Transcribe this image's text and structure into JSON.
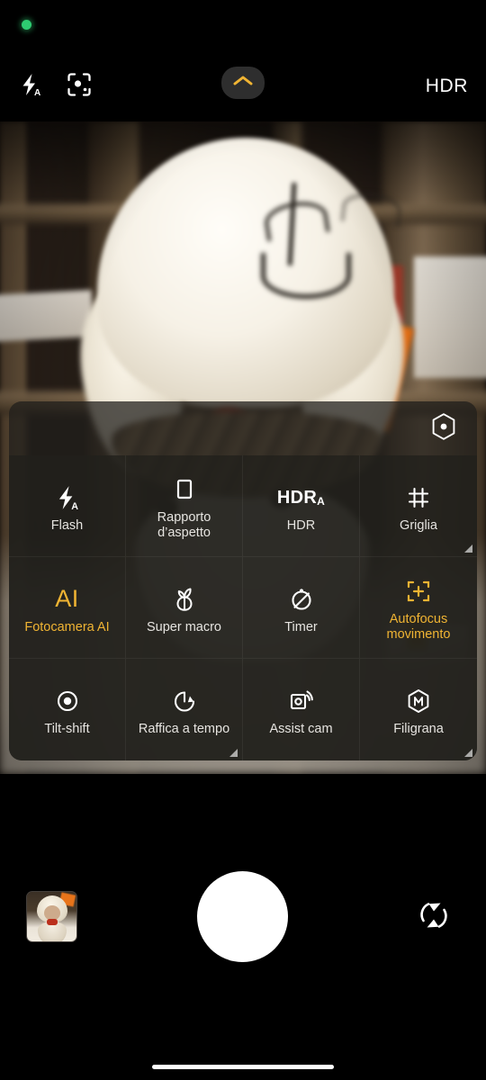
{
  "statusbar": {
    "privacy_indicator": "green-dot",
    "privacy_color": "#2ecc71"
  },
  "topbar": {
    "flash_icon": "flash-auto-icon",
    "scan_icon": "lens-scan-icon",
    "expand_icon": "chevron-up-icon",
    "expand_accent_color": "#f0b433",
    "hdr_label": "HDR"
  },
  "panel": {
    "settings_icon": "hexagon-settings-icon",
    "accent_color": "#f0b433",
    "items": [
      {
        "label": "Flash",
        "icon": "flash-auto-icon",
        "active": false,
        "expandable": false
      },
      {
        "label": "Rapporto d’aspetto",
        "icon": "aspect-ratio-icon",
        "active": false,
        "expandable": false
      },
      {
        "label": "HDR",
        "icon": "hdr-auto-icon",
        "glyph": "HDR",
        "glyph_sub": "A",
        "active": false,
        "expandable": false
      },
      {
        "label": "Griglia",
        "icon": "grid-icon",
        "active": false,
        "expandable": true
      },
      {
        "label": "Fotocamera AI",
        "icon": "ai-icon",
        "glyph": "AI",
        "active": true,
        "expandable": false
      },
      {
        "label": "Super macro",
        "icon": "flower-macro-icon",
        "active": false,
        "expandable": false
      },
      {
        "label": "Timer",
        "icon": "timer-off-icon",
        "active": false,
        "expandable": false
      },
      {
        "label": "Autofocus movimento",
        "icon": "autofocus-tracking-icon",
        "active": true,
        "expandable": false
      },
      {
        "label": "Tilt-shift",
        "icon": "tilt-shift-icon",
        "active": false,
        "expandable": false
      },
      {
        "label": "Raffica a tempo",
        "icon": "timed-burst-icon",
        "active": false,
        "expandable": true
      },
      {
        "label": "Assist cam",
        "icon": "assist-cam-icon",
        "active": false,
        "expandable": false
      },
      {
        "label": "Filigrana",
        "icon": "watermark-icon",
        "active": false,
        "expandable": true
      }
    ]
  },
  "bottombar": {
    "thumbnail": "gallery-thumbnail",
    "shutter": "shutter-button",
    "flip_icon": "flip-camera-icon",
    "home_indicator": "home-indicator"
  }
}
